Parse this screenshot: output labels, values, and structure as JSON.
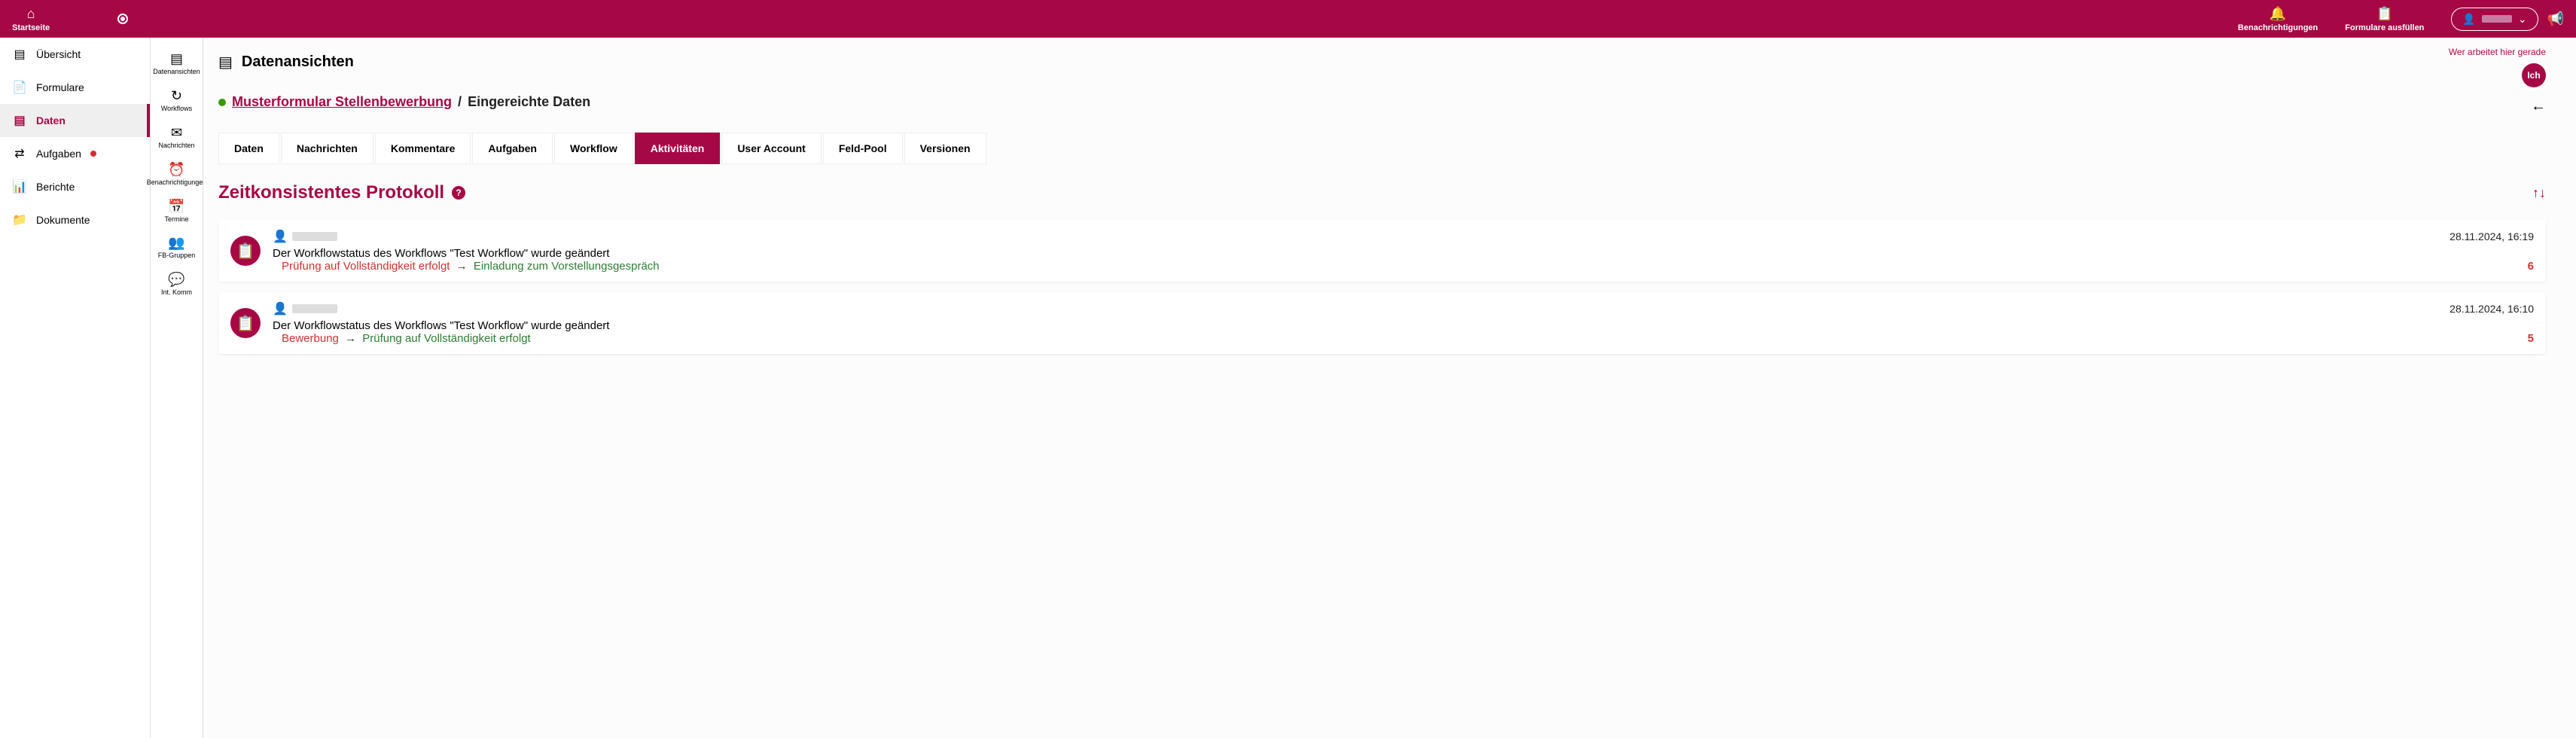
{
  "header": {
    "home": "Startseite",
    "notifications": "Benachrichtigungen",
    "forms": "Formulare ausfüllen"
  },
  "sidebar1": {
    "items": [
      {
        "icon": "dashboard",
        "label": "Übersicht"
      },
      {
        "icon": "forms",
        "label": "Formulare"
      },
      {
        "icon": "data",
        "label": "Daten",
        "active": true
      },
      {
        "icon": "checklist",
        "label": "Aufgaben",
        "dot": true
      },
      {
        "icon": "bar",
        "label": "Berichte"
      },
      {
        "icon": "folder",
        "label": "Dokumente"
      }
    ]
  },
  "sidebar2": {
    "items": [
      {
        "label": "Datenansichten"
      },
      {
        "label": "Workflows"
      },
      {
        "label": "Nachrichten"
      },
      {
        "label": "Benachrichtigungen"
      },
      {
        "label": "Termine"
      },
      {
        "label": "FB-Gruppen"
      },
      {
        "label": "Int. Komm"
      }
    ]
  },
  "content": {
    "title": "Datenansichten",
    "who_label": "Wer arbeitet hier gerade",
    "who_badge": "Ich",
    "breadcrumb_link": "Musterformular Stellenbewerbung",
    "breadcrumb_sep": "/",
    "breadcrumb_current": "Eingereichte Daten",
    "tabs": [
      "Daten",
      "Nachrichten",
      "Kommentare",
      "Aufgaben",
      "Workflow",
      "Aktivitäten",
      "User Account",
      "Feld-Pool",
      "Versionen"
    ],
    "active_tab": 5,
    "section_title": "Zeitkonsistentes Protokoll",
    "help": "?"
  },
  "activities": [
    {
      "time": "28.11.2024, 16:19",
      "desc": "Der Workflowstatus des Workflows \"Test Workflow\" wurde geändert",
      "from": "Prüfung auf Vollständigkeit erfolgt",
      "arrow": "→",
      "to": "Einladung zum Vorstellungsgespräch",
      "count": "6"
    },
    {
      "time": "28.11.2024, 16:10",
      "desc": "Der Workflowstatus des Workflows \"Test Workflow\" wurde geändert",
      "from": "Bewerbung",
      "arrow": "→",
      "to": "Prüfung auf Vollständigkeit erfolgt",
      "count": "5"
    }
  ]
}
